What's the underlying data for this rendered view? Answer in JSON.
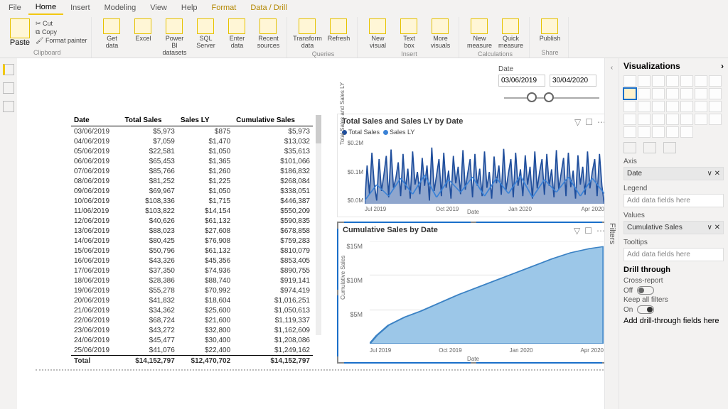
{
  "tabs": [
    "File",
    "Home",
    "Insert",
    "Modeling",
    "View",
    "Help",
    "Format",
    "Data / Drill"
  ],
  "active_tab": "Home",
  "ribbon": {
    "clipboard": {
      "paste": "Paste",
      "cut": "Cut",
      "copy": "Copy",
      "fp": "Format painter",
      "label": "Clipboard"
    },
    "data": {
      "btns": [
        "Get data",
        "Excel",
        "Power BI datasets",
        "SQL Server",
        "Enter data",
        "Recent sources"
      ],
      "label": "Data"
    },
    "queries": {
      "btns": [
        "Transform data",
        "Refresh"
      ],
      "label": "Queries"
    },
    "insert": {
      "btns": [
        "New visual",
        "Text box",
        "More visuals"
      ],
      "label": "Insert"
    },
    "calc": {
      "btns": [
        "New measure",
        "Quick measure"
      ],
      "label": "Calculations"
    },
    "share": {
      "btns": [
        "Publish"
      ],
      "label": "Share"
    }
  },
  "slicer": {
    "label": "Date",
    "from": "03/06/2019",
    "to": "30/04/2020"
  },
  "table": {
    "headers": [
      "Date",
      "Total Sales",
      "Sales LY",
      "Cumulative Sales"
    ],
    "rows": [
      [
        "03/06/2019",
        "$5,973",
        "$875",
        "$5,973"
      ],
      [
        "04/06/2019",
        "$7,059",
        "$1,470",
        "$13,032"
      ],
      [
        "05/06/2019",
        "$22,581",
        "$1,050",
        "$35,613"
      ],
      [
        "06/06/2019",
        "$65,453",
        "$1,365",
        "$101,066"
      ],
      [
        "07/06/2019",
        "$85,766",
        "$1,260",
        "$186,832"
      ],
      [
        "08/06/2019",
        "$81,252",
        "$1,225",
        "$268,084"
      ],
      [
        "09/06/2019",
        "$69,967",
        "$1,050",
        "$338,051"
      ],
      [
        "10/06/2019",
        "$108,336",
        "$1,715",
        "$446,387"
      ],
      [
        "11/06/2019",
        "$103,822",
        "$14,154",
        "$550,209"
      ],
      [
        "12/06/2019",
        "$40,626",
        "$61,132",
        "$590,835"
      ],
      [
        "13/06/2019",
        "$88,023",
        "$27,608",
        "$678,858"
      ],
      [
        "14/06/2019",
        "$80,425",
        "$76,908",
        "$759,283"
      ],
      [
        "15/06/2019",
        "$50,796",
        "$61,132",
        "$810,079"
      ],
      [
        "16/06/2019",
        "$43,326",
        "$45,356",
        "$853,405"
      ],
      [
        "17/06/2019",
        "$37,350",
        "$74,936",
        "$890,755"
      ],
      [
        "18/06/2019",
        "$28,386",
        "$88,740",
        "$919,141"
      ],
      [
        "19/06/2019",
        "$55,278",
        "$70,992",
        "$974,419"
      ],
      [
        "20/06/2019",
        "$41,832",
        "$18,604",
        "$1,016,251"
      ],
      [
        "21/06/2019",
        "$34,362",
        "$25,600",
        "$1,050,613"
      ],
      [
        "22/06/2019",
        "$68,724",
        "$21,600",
        "$1,119,337"
      ],
      [
        "23/06/2019",
        "$43,272",
        "$32,800",
        "$1,162,609"
      ],
      [
        "24/06/2019",
        "$45,477",
        "$30,400",
        "$1,208,086"
      ],
      [
        "25/06/2019",
        "$41,076",
        "$22,400",
        "$1,249,162"
      ]
    ],
    "footer": [
      "Total",
      "$14,152,797",
      "$12,470,702",
      "$14,152,797"
    ]
  },
  "chart1": {
    "title": "Total Sales and Sales LY by Date",
    "legend": [
      "Total Sales",
      "Sales LY"
    ],
    "colors": [
      "#1f4e9c",
      "#3b82d6"
    ],
    "ylabel": "Total Sales and Sales LY",
    "xlabel": "Date",
    "ticks": [
      "Jul 2019",
      "Oct 2019",
      "Jan 2020",
      "Apr 2020"
    ],
    "yticks": [
      "$0.2M",
      "$0.1M",
      "$0.0M"
    ]
  },
  "chart2": {
    "title": "Cumulative Sales by Date",
    "ylabel": "Cumulative Sales",
    "xlabel": "Date",
    "ticks": [
      "Jul 2019",
      "Oct 2019",
      "Jan 2020",
      "Apr 2020"
    ],
    "yticks": [
      "$15M",
      "$10M",
      "$5M"
    ]
  },
  "chart_data": [
    {
      "type": "line",
      "title": "Total Sales and Sales LY by Date",
      "xlabel": "Date",
      "ylabel": "Total Sales and Sales LY",
      "x_range": [
        "2019-06",
        "2020-04"
      ],
      "ylim": [
        0,
        200000
      ],
      "series": [
        {
          "name": "Total Sales",
          "note": "daily, highly variable spikes up to ~0.2M"
        },
        {
          "name": "Sales LY",
          "note": "daily, lower amplitude"
        }
      ]
    },
    {
      "type": "area",
      "title": "Cumulative Sales by Date",
      "xlabel": "Date",
      "ylabel": "Cumulative Sales",
      "x": [
        "Jun 2019",
        "Jul 2019",
        "Aug 2019",
        "Sep 2019",
        "Oct 2019",
        "Nov 2019",
        "Dec 2019",
        "Jan 2020",
        "Feb 2020",
        "Mar 2020",
        "Apr 2020"
      ],
      "values": [
        0,
        1200000,
        2600000,
        4000000,
        5400000,
        6800000,
        8200000,
        9600000,
        11000000,
        12400000,
        14152797
      ],
      "ylim": [
        0,
        15000000
      ]
    }
  ],
  "filters_label": "Filters",
  "viz": {
    "title": "Visualizations",
    "axis": {
      "label": "Axis",
      "value": "Date"
    },
    "legend": {
      "label": "Legend",
      "placeholder": "Add data fields here"
    },
    "values": {
      "label": "Values",
      "value": "Cumulative Sales"
    },
    "tooltips": {
      "label": "Tooltips",
      "placeholder": "Add data fields here"
    },
    "drill": {
      "title": "Drill through",
      "cross": "Cross-report",
      "off": "Off",
      "keep": "Keep all filters",
      "on": "On",
      "placeholder": "Add drill-through fields here"
    }
  }
}
